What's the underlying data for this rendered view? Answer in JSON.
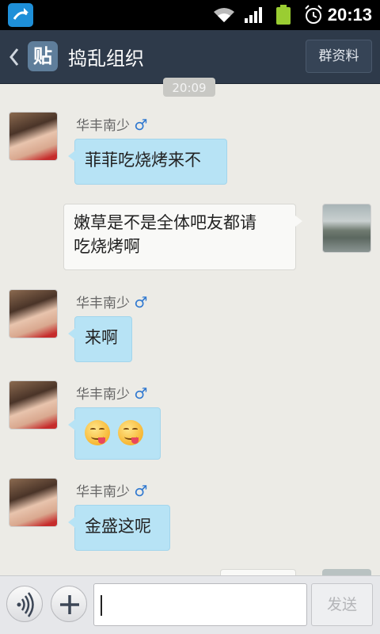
{
  "status_bar": {
    "time": "20:13",
    "icons": [
      "notification-app-icon",
      "wifi-icon",
      "signal-icon",
      "battery-icon",
      "alarm-icon"
    ]
  },
  "header": {
    "badge": "贴",
    "title": "捣乱组织",
    "group_info_label": "群资料"
  },
  "timestamp": "20:09",
  "messages": [
    {
      "direction": "in",
      "sender": "华丰南少",
      "gender": "♂",
      "text": "菲菲吃烧烤来不"
    },
    {
      "direction": "out",
      "text_line1": "嫩草是不是全体吧友都请",
      "text_line2": "吃烧烤啊"
    },
    {
      "direction": "in",
      "sender": "华丰南少",
      "gender": "♂",
      "text": "来啊"
    },
    {
      "direction": "in",
      "sender": "华丰南少",
      "gender": "♂",
      "emoji": [
        "yum-emoji",
        "yum-emoji"
      ]
    },
    {
      "direction": "in",
      "sender": "华丰南少",
      "gender": "♂",
      "text": "金盛这呢"
    }
  ],
  "input_bar": {
    "message_value": "",
    "send_label": "发送"
  },
  "colors": {
    "background": "#ecebe6",
    "header": "#2e3a4a",
    "incoming_bubble": "#b7e3f5",
    "outgoing_bubble": "#f9f9f7",
    "gender_male": "#2f78d0"
  }
}
